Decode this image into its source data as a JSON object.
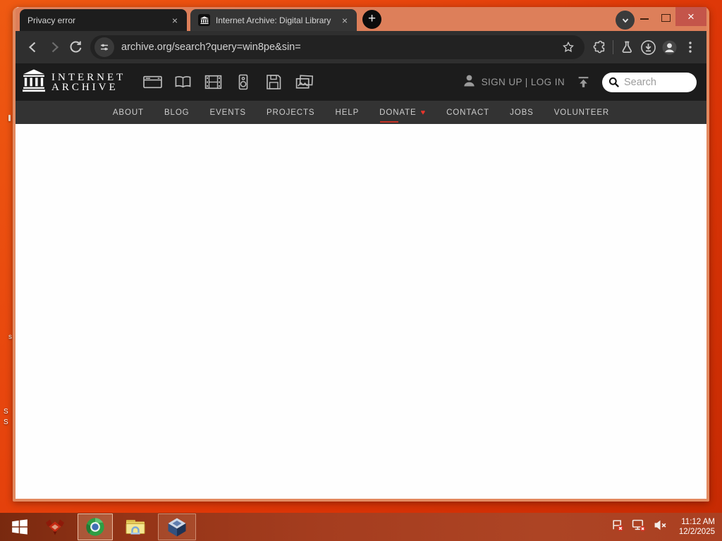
{
  "browser": {
    "tabs": [
      {
        "title": "Privacy error"
      },
      {
        "title": "Internet Archive: Digital Library"
      }
    ],
    "tab_close_glyph": "×",
    "new_tab_glyph": "+",
    "window_close_glyph": "×",
    "url": "archive.org/search?query=win8pe&sin="
  },
  "ia": {
    "wordmark": {
      "line1": "INTERNET",
      "line2": "ARCHIVE"
    },
    "account": {
      "signup_login": "SIGN UP | LOG IN"
    },
    "search_placeholder": "Search",
    "donate_heart_glyph": "♥",
    "nav": [
      {
        "label": "ABOUT"
      },
      {
        "label": "BLOG"
      },
      {
        "label": "EVENTS"
      },
      {
        "label": "PROJECTS"
      },
      {
        "label": "HELP"
      },
      {
        "label": "DONATE"
      },
      {
        "label": "CONTACT"
      },
      {
        "label": "JOBS"
      },
      {
        "label": "VOLUNTEER"
      }
    ]
  },
  "taskbar": {
    "clock": {
      "time": "11:12 AM",
      "date": "12/2/2025"
    }
  },
  "desktop": {
    "icon_label_fragments": [
      "s",
      "S",
      "S"
    ]
  },
  "colors": {
    "frame_salmon": "#dd7f5a",
    "desktop_orange": "#e8470e",
    "taskbar_red": "#a53d1f",
    "toolbar_dark": "#2f2f2f",
    "ia_header_dark": "#1c1c1c",
    "ia_nav_gray": "#333333",
    "donate_heart": "#e8352b",
    "window_close_red": "#c4554a",
    "search_box_white": "#ffffff"
  }
}
